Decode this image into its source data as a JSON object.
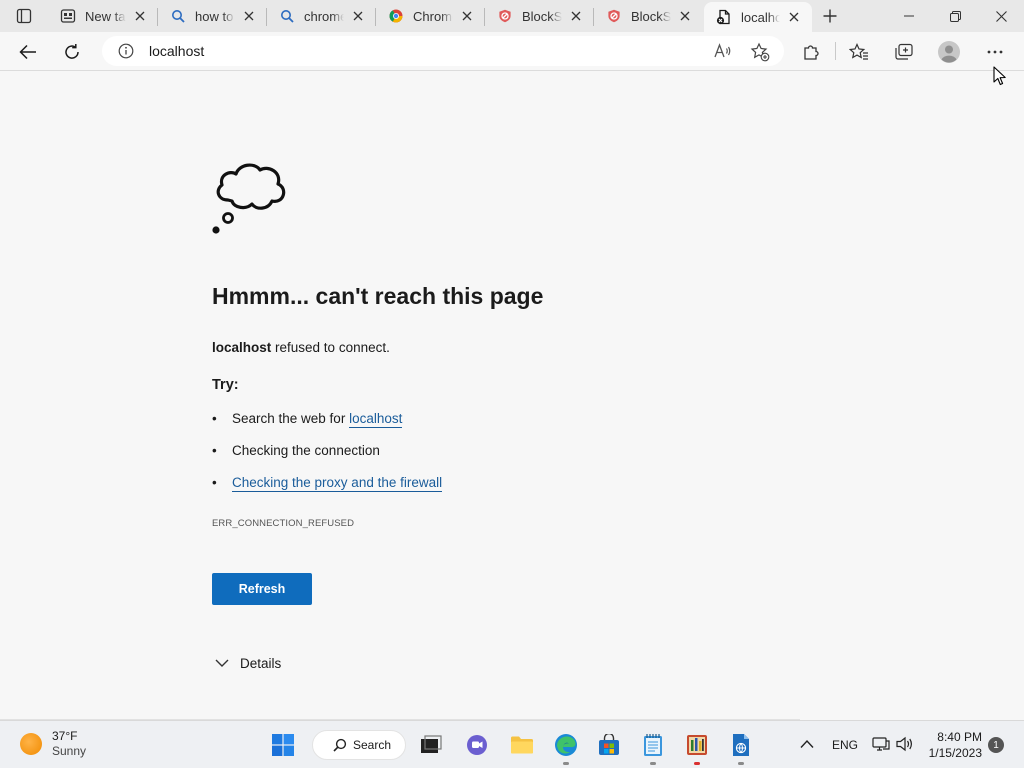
{
  "browser": {
    "tabs": [
      {
        "title": "New tab",
        "icon": "newtab-icon"
      },
      {
        "title": "how to",
        "icon": "search-icon"
      },
      {
        "title": "chrome",
        "icon": "search-icon"
      },
      {
        "title": "Chrome",
        "icon": "chrome-icon"
      },
      {
        "title": "BlockSit",
        "icon": "blocksite-icon"
      },
      {
        "title": "BlockSit",
        "icon": "blocksite-icon"
      },
      {
        "title": "localhos",
        "icon": "document-error-icon",
        "active": true
      }
    ],
    "address": "localhost"
  },
  "error_page": {
    "title": "Hmmm... can't reach this page",
    "host": "localhost",
    "description_suffix": "refused to connect.",
    "try_label": "Try:",
    "suggestion_search_prefix": "Search the web for",
    "suggestion_search_link": "localhost",
    "suggestion_connection": "Checking the connection",
    "suggestion_proxy_link": "Checking the proxy and the firewall",
    "error_code": "ERR_CONNECTION_REFUSED",
    "refresh_label": "Refresh",
    "details_label": "Details"
  },
  "taskbar": {
    "weather_temp": "37°F",
    "weather_condition": "Sunny",
    "search_label": "Search",
    "language": "ENG",
    "time": "8:40 PM",
    "date": "1/15/2023",
    "notification_count": "1"
  },
  "colors": {
    "accent": "#0f6cbd",
    "link": "#1a5c9a"
  }
}
